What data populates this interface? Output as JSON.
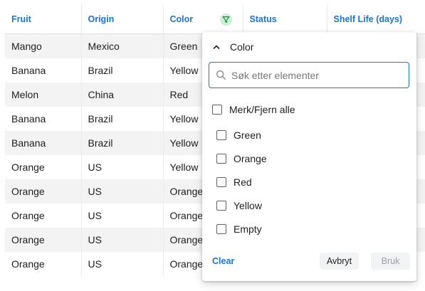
{
  "columns": [
    {
      "label": "Fruit"
    },
    {
      "label": "Origin"
    },
    {
      "label": "Color"
    },
    {
      "label": "Status"
    },
    {
      "label": "Shelf Life (days)"
    }
  ],
  "rows": [
    [
      "Mango",
      "Mexico",
      "Green",
      "",
      ""
    ],
    [
      "Banana",
      "Brazil",
      "Yellow",
      "",
      ""
    ],
    [
      "Melon",
      "China",
      "Red",
      "",
      ""
    ],
    [
      "Banana",
      "Brazil",
      "Yellow",
      "",
      ""
    ],
    [
      "Banana",
      "Brazil",
      "Yellow",
      "",
      ""
    ],
    [
      "Orange",
      "US",
      "Yellow",
      "",
      ""
    ],
    [
      "Orange",
      "US",
      "Orange",
      "",
      ""
    ],
    [
      "Orange",
      "US",
      "Orange",
      "",
      ""
    ],
    [
      "Orange",
      "US",
      "Orange",
      "",
      ""
    ],
    [
      "Orange",
      "US",
      "Orange",
      "",
      ""
    ]
  ],
  "filter_popup": {
    "title": "Color",
    "search_placeholder": "Søk etter elementer",
    "select_all_label": "Merk/Fjern alle",
    "options": [
      {
        "label": "Green",
        "checked": false
      },
      {
        "label": "Orange",
        "checked": false
      },
      {
        "label": "Red",
        "checked": false
      },
      {
        "label": "Yellow",
        "checked": false
      },
      {
        "label": "Empty",
        "checked": false
      }
    ],
    "clear_label": "Clear",
    "cancel_label": "Avbryt",
    "apply_label": "Bruk"
  },
  "icons": {
    "filter": "filter-funnel-icon",
    "collapse": "chevron-up-icon",
    "search": "search-icon"
  },
  "colors": {
    "accent": "#1a73e8",
    "filter_active_bg": "#cdeed6",
    "filter_active_fg": "#1e8e3e",
    "row_alt": "#f3f3f3"
  }
}
